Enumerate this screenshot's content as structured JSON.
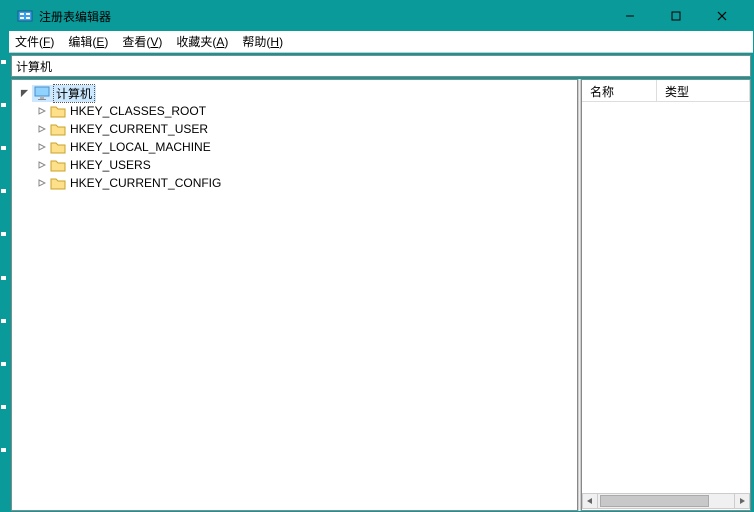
{
  "titlebar": {
    "title": "注册表编辑器"
  },
  "menu": {
    "file": "文件(F)",
    "edit": "编辑(E)",
    "view": "查看(V)",
    "favorites": "收藏夹(A)",
    "help": "帮助(H)"
  },
  "address": {
    "path": "计算机"
  },
  "tree": {
    "root": {
      "label": "计算机"
    },
    "hives": [
      {
        "label": "HKEY_CLASSES_ROOT"
      },
      {
        "label": "HKEY_CURRENT_USER"
      },
      {
        "label": "HKEY_LOCAL_MACHINE"
      },
      {
        "label": "HKEY_USERS"
      },
      {
        "label": "HKEY_CURRENT_CONFIG"
      }
    ]
  },
  "list": {
    "col_name": "名称",
    "col_type": "类型"
  }
}
